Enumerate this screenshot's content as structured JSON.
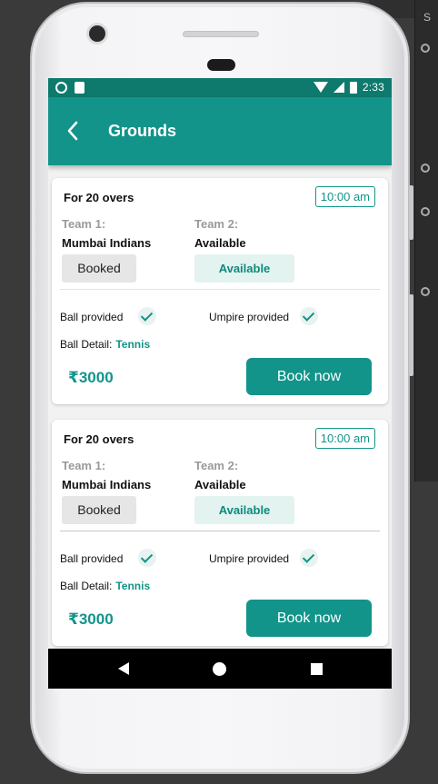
{
  "ide": {
    "tab_text": "S"
  },
  "status_bar": {
    "time": "2:33"
  },
  "app_bar": {
    "title": "Grounds"
  },
  "cards": [
    {
      "overs": "For 20 overs",
      "time": "10:00 am",
      "team1_label": "Team 1:",
      "team1_name": "Mumbai Indians",
      "team1_status": "Booked",
      "team2_label": "Team 2:",
      "team2_name": "Available",
      "team2_status": "Available",
      "ball_provided_label": "Ball provided",
      "ball_provided": true,
      "umpire_provided_label": "Umpire provided",
      "umpire_provided": true,
      "ball_detail_label": "Ball Detail:",
      "ball_detail_value": "Tennis",
      "price": "₹3000",
      "book_label": "Book now"
    },
    {
      "overs": "For 20 overs",
      "time": "10:00 am",
      "team1_label": "Team 1:",
      "team1_name": "Mumbai Indians",
      "team1_status": "Booked",
      "team2_label": "Team 2:",
      "team2_name": "Available",
      "team2_status": "Available",
      "ball_provided_label": "Ball provided",
      "ball_provided": true,
      "umpire_provided_label": "Umpire provided",
      "umpire_provided": true,
      "ball_detail_label": "Ball Detail:",
      "ball_detail_value": "Tennis",
      "price": "₹3000",
      "book_label": "Book now"
    }
  ],
  "colors": {
    "primary": "#12948a",
    "status_bar": "#0d7a6d",
    "available_bg": "#e3f3f0",
    "booked_bg": "#e6e6e6"
  },
  "nav_bar": {
    "icons": [
      "back-triangle-icon",
      "home-circle-icon",
      "recents-square-icon"
    ]
  }
}
